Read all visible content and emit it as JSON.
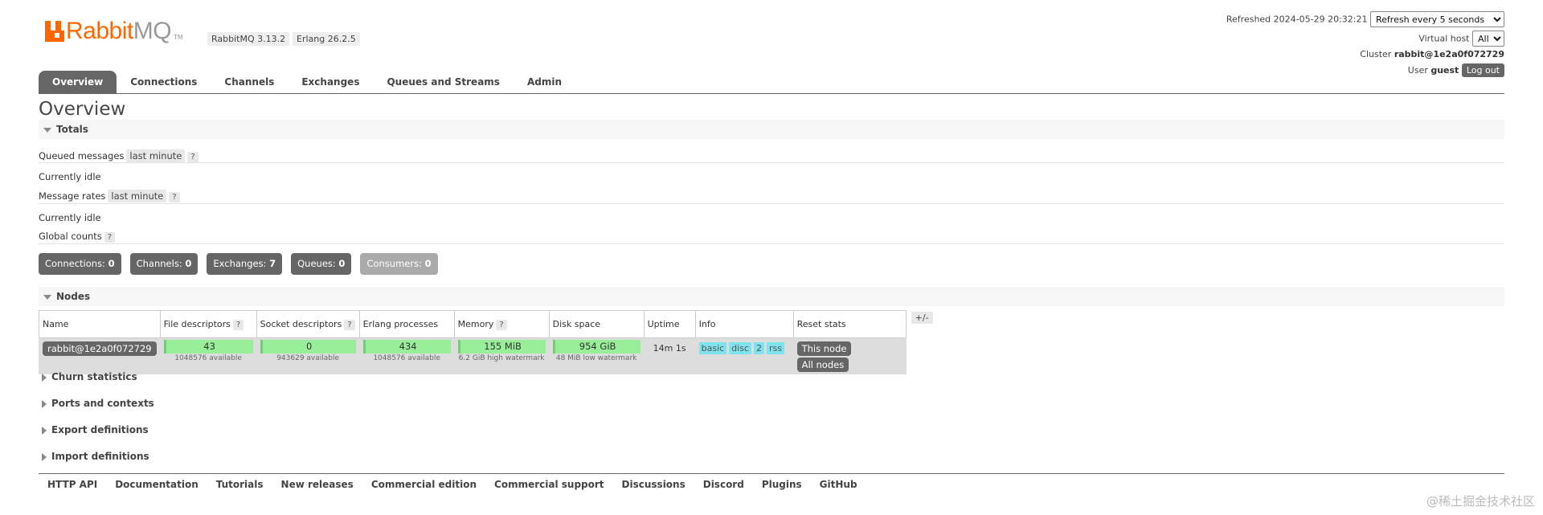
{
  "brand": {
    "rabbit": "Rabbit",
    "mq": "MQ",
    "tm": "TM",
    "version": "RabbitMQ 3.13.2",
    "erlang": "Erlang 26.2.5"
  },
  "header": {
    "refreshed_label": "Refreshed",
    "refreshed_time": "2024-05-29 20:32:21",
    "refresh_select": "Refresh every 5 seconds",
    "vhost_label": "Virtual host",
    "vhost_select": "All",
    "cluster_label": "Cluster",
    "cluster_name": "rabbit@1e2a0f072729",
    "user_label": "User",
    "user_name": "guest",
    "logout_label": "Log out"
  },
  "tabs": [
    "Overview",
    "Connections",
    "Channels",
    "Exchanges",
    "Queues and Streams",
    "Admin"
  ],
  "page_title": "Overview",
  "totals": {
    "title": "Totals",
    "queued_label": "Queued messages",
    "queued_range": "last minute",
    "help": "?",
    "queued_status": "Currently idle",
    "rates_label": "Message rates",
    "rates_range": "last minute",
    "rates_status": "Currently idle",
    "global_label": "Global counts"
  },
  "counts": [
    {
      "label": "Connections:",
      "value": "0"
    },
    {
      "label": "Channels:",
      "value": "0"
    },
    {
      "label": "Exchanges:",
      "value": "7"
    },
    {
      "label": "Queues:",
      "value": "0"
    },
    {
      "label": "Consumers:",
      "value": "0"
    }
  ],
  "nodes": {
    "title": "Nodes",
    "headers": [
      "Name",
      "File descriptors",
      "Socket descriptors",
      "Erlang processes",
      "Memory",
      "Disk space",
      "Uptime",
      "Info",
      "Reset stats"
    ],
    "plus_minus": "+/-",
    "row": {
      "name": "rabbit@1e2a0f072729",
      "fd": "43",
      "fd_sub": "1048576 available",
      "sock": "0",
      "sock_sub": "943629 available",
      "erl": "434",
      "erl_sub": "1048576 available",
      "mem": "155 MiB",
      "mem_sub": "6.2 GiB high watermark",
      "disk": "954 GiB",
      "disk_sub": "48 MiB low watermark",
      "uptime": "14m 1s",
      "info": [
        "basic",
        "disc",
        "2",
        "rss"
      ],
      "reset_this": "This node",
      "reset_all": "All nodes"
    }
  },
  "collapsed_sections": [
    "Churn statistics",
    "Ports and contexts",
    "Export definitions",
    "Import definitions"
  ],
  "footer": [
    "HTTP API",
    "Documentation",
    "Tutorials",
    "New releases",
    "Commercial edition",
    "Commercial support",
    "Discussions",
    "Discord",
    "Plugins",
    "GitHub"
  ],
  "watermark": "@稀土掘金技术社区",
  "colors": {
    "accent": "#ff6600",
    "tab_active": "#666666",
    "gauge_green": "#99ee99",
    "info_cyan": "#7ee3ec"
  }
}
